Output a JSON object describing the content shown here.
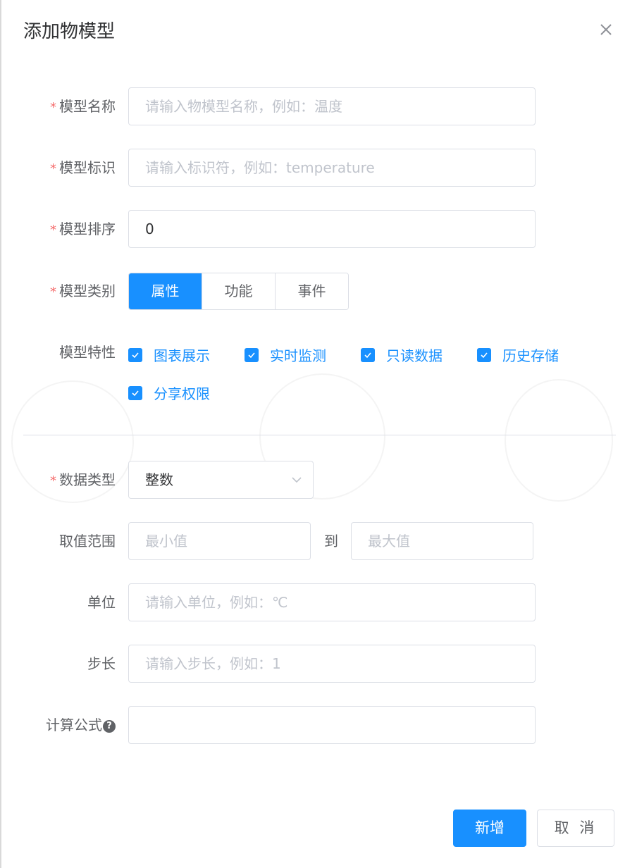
{
  "dialog": {
    "title": "添加物模型",
    "close_icon": "close-icon"
  },
  "form": {
    "name": {
      "label": "模型名称",
      "required": true,
      "placeholder": "请输入物模型名称，例如：温度",
      "value": ""
    },
    "identifier": {
      "label": "模型标识",
      "required": true,
      "placeholder": "请输入标识符，例如：temperature",
      "value": ""
    },
    "order": {
      "label": "模型排序",
      "required": true,
      "placeholder": "",
      "value": "0"
    },
    "type": {
      "label": "模型类别",
      "required": true,
      "options": [
        "属性",
        "功能",
        "事件"
      ],
      "selected": "属性"
    },
    "features": {
      "label": "模型特性",
      "items": [
        {
          "label": "图表展示",
          "checked": true
        },
        {
          "label": "实时监测",
          "checked": true
        },
        {
          "label": "只读数据",
          "checked": true
        },
        {
          "label": "历史存储",
          "checked": true
        },
        {
          "label": "分享权限",
          "checked": true
        }
      ]
    },
    "datatype": {
      "label": "数据类型",
      "required": true,
      "value": "整数"
    },
    "range": {
      "label": "取值范围",
      "min_placeholder": "最小值",
      "to": "到",
      "max_placeholder": "最大值"
    },
    "unit": {
      "label": "单位",
      "placeholder": "请输入单位，例如：℃"
    },
    "step": {
      "label": "步长",
      "placeholder": "请输入步长，例如：1"
    },
    "formula": {
      "label": "计算公式",
      "help": "?"
    }
  },
  "footer": {
    "confirm_label": "新增",
    "cancel_label": "取 消"
  },
  "colors": {
    "primary": "#1890ff",
    "required": "#f56c6c",
    "border": "#dcdfe6"
  }
}
